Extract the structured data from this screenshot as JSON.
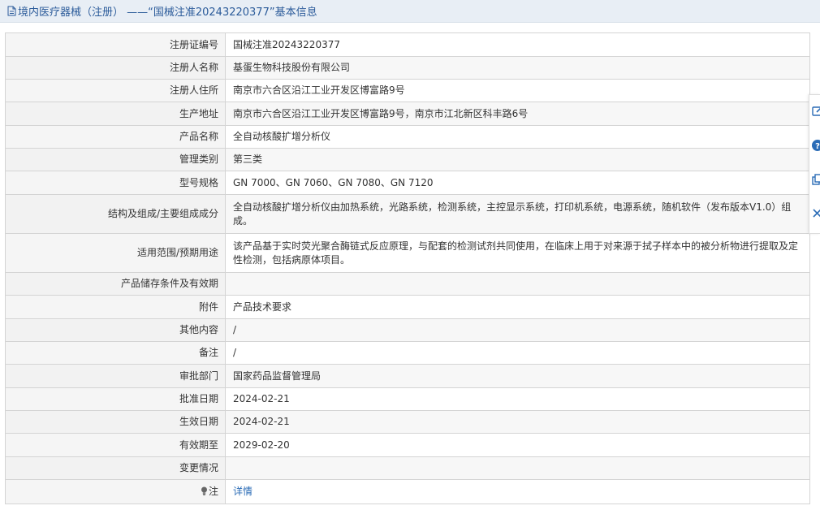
{
  "header": {
    "title": "境内医疗器械（注册） ——“国械注准20243220377”基本信息"
  },
  "colors": {
    "title_text": "#2b5b9a",
    "title_bg": "#e8eef5",
    "label_bg": "#f5f5f5",
    "link": "#2b6cb6",
    "border": "#d4d4d4"
  },
  "record": {
    "rows": [
      {
        "label": "注册证编号",
        "value": "国械注准20243220377"
      },
      {
        "label": "注册人名称",
        "value": "基蛋生物科技股份有限公司"
      },
      {
        "label": "注册人住所",
        "value": "南京市六合区沿江工业开发区博富路9号"
      },
      {
        "label": "生产地址",
        "value": "南京市六合区沿江工业开发区博富路9号，南京市江北新区科丰路6号"
      },
      {
        "label": "产品名称",
        "value": "全自动核酸扩增分析仪"
      },
      {
        "label": "管理类别",
        "value": "第三类"
      },
      {
        "label": "型号规格",
        "value": "GN 7000、GN 7060、GN 7080、GN 7120"
      },
      {
        "label": "结构及组成/主要组成成分",
        "value": "全自动核酸扩增分析仪由加热系统，光路系统，检测系统，主控显示系统，打印机系统，电源系统，随机软件（发布版本V1.0）组成。"
      },
      {
        "label": "适用范围/预期用途",
        "value": "该产品基于实时荧光聚合酶链式反应原理，与配套的检测试剂共同使用，在临床上用于对来源于拭子样本中的被分析物进行提取及定性检测，包括病原体项目。"
      },
      {
        "label": "产品储存条件及有效期",
        "value": ""
      },
      {
        "label": "附件",
        "value": "产品技术要求"
      },
      {
        "label": "其他内容",
        "value": "/"
      },
      {
        "label": "备注",
        "value": "/"
      },
      {
        "label": "审批部门",
        "value": "国家药品监督管理局"
      },
      {
        "label": "批准日期",
        "value": "2024-02-21"
      },
      {
        "label": "生效日期",
        "value": "2024-02-21"
      },
      {
        "label": "有效期至",
        "value": "2029-02-20"
      },
      {
        "label": "变更情况",
        "value": ""
      },
      {
        "label": "注",
        "value": "详情"
      }
    ]
  },
  "side_tools": {
    "icons": [
      "edit-icon",
      "help-icon",
      "copy-icon",
      "close-icon"
    ]
  }
}
